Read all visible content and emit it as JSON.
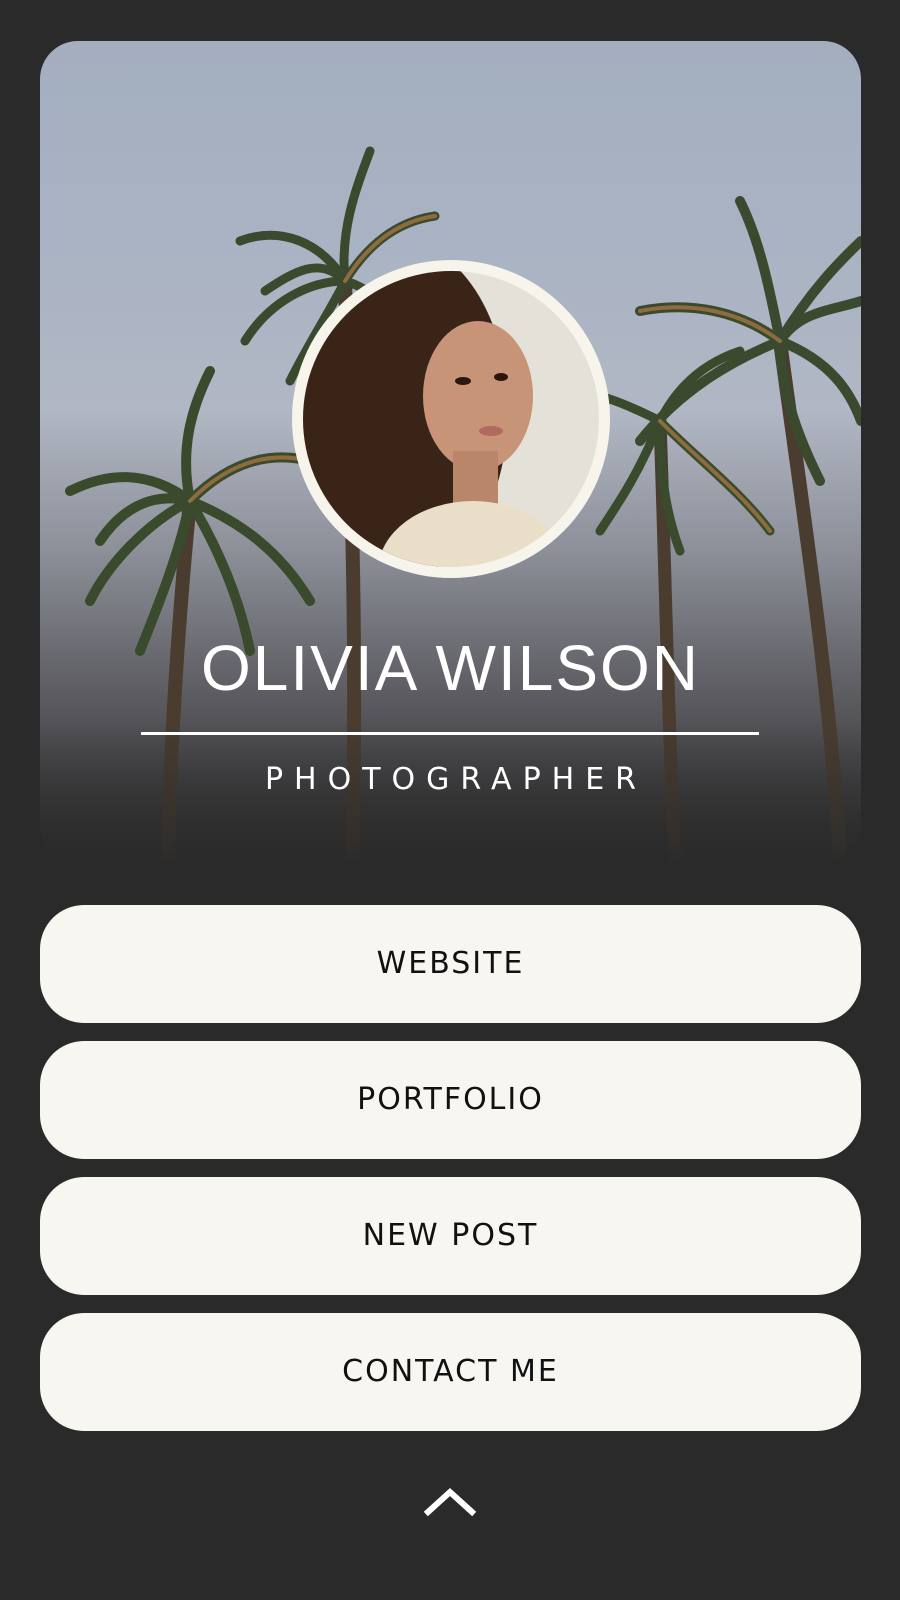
{
  "profile": {
    "name": "OLIVIA WILSON",
    "role": "PHOTOGRAPHER"
  },
  "links": [
    {
      "label": "WEBSITE"
    },
    {
      "label": "PORTFOLIO"
    },
    {
      "label": "NEW POST"
    },
    {
      "label": "CONTACT ME"
    }
  ],
  "icons": {
    "scroll_top": "chevron-up-icon",
    "avatar": "profile-photo"
  },
  "colors": {
    "page_background": "#2a2a2a",
    "button_background": "#f8f6f1",
    "button_text": "#111111",
    "hero_text": "#ffffff",
    "avatar_ring": "#f7f4ec"
  }
}
